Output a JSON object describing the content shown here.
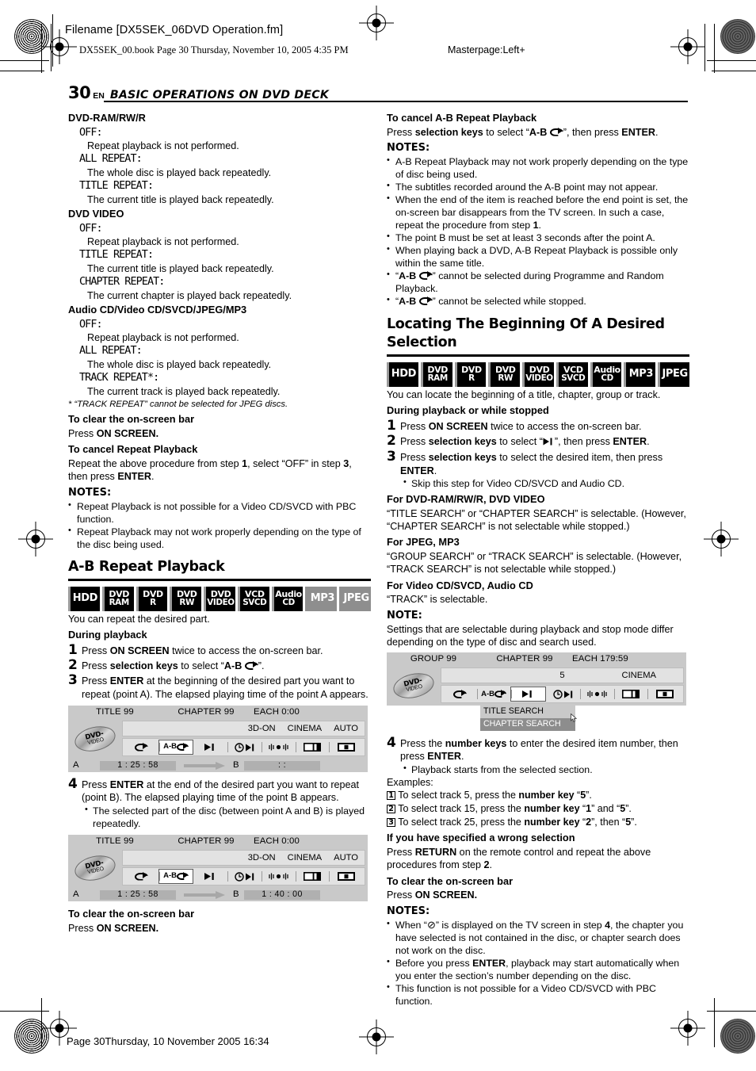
{
  "header": {
    "filename": "Filename [DX5SEK_06DVD Operation.fm]",
    "bookline": "DX5SEK_00.book  Page 30  Thursday, November 10, 2005  4:35 PM",
    "masterpage": "Masterpage:Left+"
  },
  "running_head": {
    "page_number": "30",
    "lang": "EN",
    "chapter": "BASIC OPERATIONS ON DVD DECK"
  },
  "footer": {
    "text": "Page 30Thursday, 10 November 2005  16:34"
  },
  "left": {
    "groups": [
      {
        "title": "DVD-RAM/RW/R",
        "options": [
          {
            "name": "OFF:",
            "desc": "Repeat playback is not performed."
          },
          {
            "name": "ALL REPEAT:",
            "desc": "The whole disc is played back repeatedly."
          },
          {
            "name": "TITLE REPEAT:",
            "desc": "The current title is played back repeatedly."
          }
        ]
      },
      {
        "title": "DVD VIDEO",
        "options": [
          {
            "name": "OFF:",
            "desc": "Repeat playback is not performed."
          },
          {
            "name": "TITLE REPEAT:",
            "desc": "The current title is played back repeatedly."
          },
          {
            "name": "CHAPTER REPEAT:",
            "desc": "The current chapter is played back repeatedly."
          }
        ]
      },
      {
        "title": "Audio CD/Video CD/SVCD/JPEG/MP3",
        "options": [
          {
            "name": "OFF:",
            "desc": "Repeat playback is not performed."
          },
          {
            "name": "ALL REPEAT:",
            "desc": "The whole disc is played back repeatedly."
          },
          {
            "name": "TRACK REPEAT*:",
            "desc": "The current track is played back repeatedly."
          }
        ]
      }
    ],
    "footnote": "* “TRACK REPEAT” cannot be selected for JPEG discs.",
    "clear_bar_title": "To clear the on-screen bar",
    "clear_bar_text_pre": "Press ",
    "clear_bar_text_bold": "ON SCREEN.",
    "cancel_title": "To cancel Repeat Playback",
    "cancel_text": "Repeat the above procedure from step 1, select “OFF” in step 3, then press ENTER.",
    "notes_label": "NOTES:",
    "notes": [
      "Repeat Playback is not possible for a Video CD/SVCD with PBC function.",
      "Repeat Playback may not work properly depending on the type of the disc being used."
    ],
    "section_title": "A-B Repeat Playback",
    "badges": [
      {
        "l1": "HDD",
        "l2": "",
        "dim": false,
        "single": true
      },
      {
        "l1": "DVD",
        "l2": "RAM",
        "dim": false,
        "single": false
      },
      {
        "l1": "DVD",
        "l2": "R",
        "dim": false,
        "single": false
      },
      {
        "l1": "DVD",
        "l2": "RW",
        "dim": false,
        "single": false
      },
      {
        "l1": "DVD",
        "l2": "VIDEO",
        "dim": false,
        "single": false
      },
      {
        "l1": "VCD",
        "l2": "SVCD",
        "dim": false,
        "single": false
      },
      {
        "l1": "Audio",
        "l2": "CD",
        "dim": false,
        "single": false
      },
      {
        "l1": "MP3",
        "l2": "",
        "dim": true,
        "single": true
      },
      {
        "l1": "JPEG",
        "l2": "",
        "dim": true,
        "single": true
      }
    ],
    "intro": "You can repeat the desired part.",
    "during_playback": "During playback",
    "steps": [
      {
        "n": "1",
        "text": "Press ON SCREEN twice to access the on-screen bar."
      },
      {
        "n": "2",
        "text": "Press selection keys to select “A-B ↺”."
      },
      {
        "n": "3",
        "text": "Press ENTER at the beginning of the desired part you want to repeat (point A). The elapsed playing time of the point A appears."
      }
    ],
    "step4": {
      "n": "4",
      "text": "Press ENTER at the end of the desired part you want to repeat (point B). The elapsed playing time of the point B appears."
    },
    "step4_sub": "The selected part of the disc (between point A and B) is played repeatedly.",
    "clear_bar_title2": "To clear the on-screen bar",
    "clear_bar_text2_pre": "Press ",
    "clear_bar_text2_bold": "ON SCREEN.",
    "figure_a": {
      "row1": [
        "TITLE 99",
        "CHAPTER 99",
        "EACH 0:00"
      ],
      "disc_label_1": "DVD-",
      "disc_label_2": "VIDEO",
      "status": [
        "3D-ON",
        "CINEMA",
        "AUTO"
      ],
      "icons": [
        "repeat-icon",
        "ab-repeat-icon",
        "skip-search-icon",
        "time-search-icon",
        "audio-icon",
        "subtitle-icon",
        "angle-icon"
      ],
      "ab_label": "A-B",
      "a_label": "A",
      "a_time": "1 : 25 : 58",
      "b_label": "B",
      "b_time": ":   :"
    },
    "figure_b": {
      "row1": [
        "TITLE 99",
        "CHAPTER 99",
        "EACH 0:00"
      ],
      "disc_label_1": "DVD-",
      "disc_label_2": "VIDEO",
      "status": [
        "3D-ON",
        "CINEMA",
        "AUTO"
      ],
      "ab_label": "A-B",
      "a_label": "A",
      "a_time": "1 : 25 : 58",
      "b_label": "B",
      "b_time": "1 : 40 : 00"
    }
  },
  "right": {
    "cancel_ab_title": "To cancel A-B Repeat Playback",
    "cancel_ab_text": "Press selection keys to select “A-B ↺”, then press ENTER.",
    "notes_label": "NOTES:",
    "notes": [
      "A-B Repeat Playback may not work properly depending on the type of disc being used.",
      "The subtitles recorded around the A-B point may not appear.",
      "When the end of the item is reached before the end point is set, the on-screen bar disappears from the TV screen. In such a case, repeat the procedure from step 1.",
      "The point B must be set at least 3 seconds after the point A.",
      "When playing back a DVD, A-B Repeat Playback is possible only within the same title.",
      "“A-B ↺” cannot be selected during Programme and Random Playback.",
      "“A-B ↺” cannot be selected while stopped."
    ],
    "section_title": "Locating The Beginning Of A Desired Selection",
    "badges": [
      {
        "l1": "HDD",
        "l2": "",
        "dim": false,
        "single": true
      },
      {
        "l1": "DVD",
        "l2": "RAM",
        "dim": false,
        "single": false
      },
      {
        "l1": "DVD",
        "l2": "R",
        "dim": false,
        "single": false
      },
      {
        "l1": "DVD",
        "l2": "RW",
        "dim": false,
        "single": false
      },
      {
        "l1": "DVD",
        "l2": "VIDEO",
        "dim": false,
        "single": false
      },
      {
        "l1": "VCD",
        "l2": "SVCD",
        "dim": false,
        "single": false
      },
      {
        "l1": "Audio",
        "l2": "CD",
        "dim": false,
        "single": false
      },
      {
        "l1": "MP3",
        "l2": "",
        "dim": false,
        "single": true
      },
      {
        "l1": "JPEG",
        "l2": "",
        "dim": false,
        "single": true
      }
    ],
    "intro": "You can locate the beginning of a title, chapter, group or track.",
    "during": "During playback or while stopped",
    "steps": [
      {
        "n": "1",
        "text": "Press ON SCREEN twice to access the on-screen bar."
      },
      {
        "n": "2",
        "text": "Press selection keys to select “➜|”, then press ENTER."
      },
      {
        "n": "3",
        "text": "Press selection keys to select the desired item, then press ENTER."
      }
    ],
    "step3_sub": "Skip this step for Video CD/SVCD and Audio CD.",
    "blocks": [
      {
        "title": "For DVD-RAM/RW/R, DVD VIDEO",
        "text": "“TITLE SEARCH” or “CHAPTER SEARCH” is selectable. (However, “CHAPTER SEARCH” is not selectable while stopped.)"
      },
      {
        "title": "For JPEG, MP3",
        "text": "“GROUP SEARCH” or “TRACK SEARCH” is selectable. (However, “TRACK SEARCH” is not selectable while stopped.)"
      },
      {
        "title": "For Video CD/SVCD, Audio CD",
        "text": "“TRACK” is selectable."
      }
    ],
    "note_label": "NOTE:",
    "note_text": "Settings that are selectable during playback and stop mode differ depending on the type of disc and search used.",
    "figure_c": {
      "row1": [
        "GROUP 99",
        "CHAPTER 99",
        "EACH 179:59"
      ],
      "disc_label_1": "DVD-",
      "disc_label_2": "VIDEO",
      "status_center": "5",
      "status_right": "CINEMA",
      "ab_label": "A-B",
      "dropdown": [
        "TITLE SEARCH",
        "CHAPTER SEARCH"
      ]
    },
    "step4": {
      "n": "4",
      "text": "Press the number keys to enter the desired item number, then press ENTER."
    },
    "step4_sub": "Playback starts from the selected section.",
    "examples_label": "Examples:",
    "examples": [
      {
        "n": "1",
        "text": "To select track 5, press the number key “5”."
      },
      {
        "n": "2",
        "text": "To select track 15, press the number key “1” and “5”."
      },
      {
        "n": "3",
        "text": "To select track 25, press the number key “2”, then “5”."
      }
    ],
    "wrong_title": "If you have specified a wrong selection",
    "wrong_text": "Press RETURN on the remote control and repeat the above procedures from step 2.",
    "clear_title": "To clear the on-screen bar",
    "clear_pre": "Press ",
    "clear_bold": "ON SCREEN.",
    "notes2_label": "NOTES:",
    "notes2": [
      "When “⊘” is displayed on the TV screen in step 4, the chapter you have selected is not contained in the disc, or chapter search does not work on the disc.",
      "Before you press ENTER, playback may start automatically when you enter the section’s number depending on the disc.",
      "This function is not possible for a Video CD/SVCD with PBC function."
    ]
  }
}
